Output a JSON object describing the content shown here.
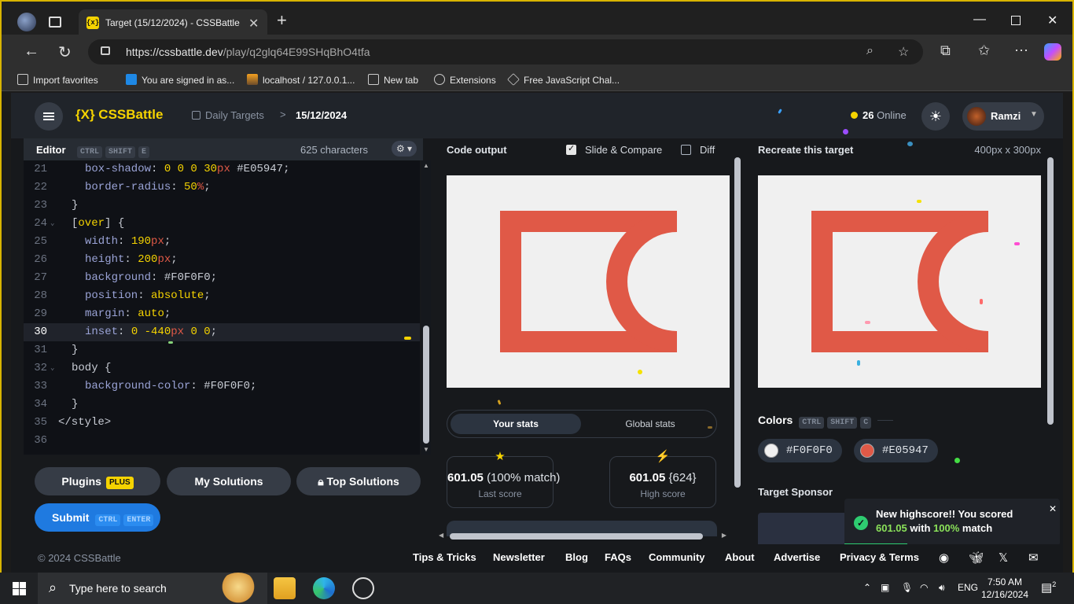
{
  "browser": {
    "tab_title": "Target (15/12/2024) - CSSBattle",
    "tab_favicon": "{x}",
    "url_host": "https://cssbattle.dev",
    "url_path": "/play/q2glq64E99SHqBhO4tfa",
    "bookmarks": [
      {
        "label": "Import favorites",
        "icon": "import-icon"
      },
      {
        "label": "You are signed in as...",
        "icon": "s-logo-icon"
      },
      {
        "label": "localhost / 127.0.0.1...",
        "icon": "phpmyadmin-icon"
      },
      {
        "label": "New tab",
        "icon": "page-icon"
      },
      {
        "label": "Extensions",
        "icon": "extensions-icon"
      },
      {
        "label": "Free JavaScript Chal...",
        "icon": "cube-icon"
      }
    ]
  },
  "header": {
    "logo": "{X} CSSBattle",
    "breadcrumb_root": "Daily Targets",
    "breadcrumb_sep": ">",
    "breadcrumb_current": "15/12/2024",
    "online_count": "26",
    "online_label": "Online",
    "user_name": "Ramzi"
  },
  "editor": {
    "title": "Editor",
    "shortcut": [
      "CTRL",
      "SHIFT",
      "E"
    ],
    "char_count": "625 characters",
    "active_line": 30,
    "lines": [
      {
        "no": "21",
        "indent": 2,
        "parts": [
          [
            "p",
            "box-shadow"
          ],
          [
            "s",
            ": "
          ],
          [
            "v",
            "0 0 0 30"
          ],
          [
            "u",
            "px"
          ],
          [
            "s",
            " #E05947;"
          ]
        ]
      },
      {
        "no": "22",
        "indent": 2,
        "parts": [
          [
            "p",
            "border-radius"
          ],
          [
            "s",
            ": "
          ],
          [
            "v",
            "50"
          ],
          [
            "u",
            "%"
          ],
          [
            "s",
            ";"
          ]
        ]
      },
      {
        "no": "23",
        "indent": 1,
        "parts": [
          [
            "k",
            "}"
          ]
        ]
      },
      {
        "no": "24",
        "indent": 1,
        "fold": true,
        "parts": [
          [
            "k",
            "["
          ],
          [
            "v",
            "over"
          ],
          [
            "k",
            "] {"
          ]
        ]
      },
      {
        "no": "25",
        "indent": 2,
        "parts": [
          [
            "p",
            "width"
          ],
          [
            "s",
            ": "
          ],
          [
            "v",
            "190"
          ],
          [
            "u",
            "px"
          ],
          [
            "s",
            ";"
          ]
        ]
      },
      {
        "no": "26",
        "indent": 2,
        "parts": [
          [
            "p",
            "height"
          ],
          [
            "s",
            ": "
          ],
          [
            "v",
            "200"
          ],
          [
            "u",
            "px"
          ],
          [
            "s",
            ";"
          ]
        ]
      },
      {
        "no": "27",
        "indent": 2,
        "parts": [
          [
            "p",
            "background"
          ],
          [
            "s",
            ": #F0F0F0;"
          ]
        ]
      },
      {
        "no": "28",
        "indent": 2,
        "parts": [
          [
            "p",
            "position"
          ],
          [
            "s",
            ": "
          ],
          [
            "v",
            "absolute"
          ],
          [
            "s",
            ";"
          ]
        ]
      },
      {
        "no": "29",
        "indent": 2,
        "parts": [
          [
            "p",
            "margin"
          ],
          [
            "s",
            ": "
          ],
          [
            "v",
            "auto"
          ],
          [
            "s",
            ";"
          ]
        ]
      },
      {
        "no": "30",
        "indent": 2,
        "parts": [
          [
            "p",
            "inset"
          ],
          [
            "s",
            ": "
          ],
          [
            "v",
            "0 -440"
          ],
          [
            "u",
            "px"
          ],
          [
            "v",
            " 0 0"
          ],
          [
            "s",
            ";"
          ]
        ]
      },
      {
        "no": "31",
        "indent": 1,
        "parts": [
          [
            "k",
            "}"
          ]
        ]
      },
      {
        "no": "32",
        "indent": 1,
        "fold": true,
        "parts": [
          [
            "k",
            "body {"
          ]
        ]
      },
      {
        "no": "33",
        "indent": 2,
        "parts": [
          [
            "p",
            "background-color"
          ],
          [
            "s",
            ": #F0F0F0;"
          ]
        ]
      },
      {
        "no": "34",
        "indent": 1,
        "parts": [
          [
            "k",
            "}"
          ]
        ]
      },
      {
        "no": "35",
        "indent": 0,
        "parts": [
          [
            "k",
            "</style>"
          ]
        ]
      },
      {
        "no": "36",
        "indent": 0,
        "parts": []
      }
    ]
  },
  "buttons": {
    "plugins": "Plugins",
    "plus_badge": "PLUS",
    "my_solutions": "My Solutions",
    "top_solutions": "Top Solutions",
    "submit": "Submit",
    "submit_keys": [
      "CTRL",
      "ENTER"
    ]
  },
  "output": {
    "title": "Code output",
    "slide_compare": "Slide & Compare",
    "slide_compare_checked": true,
    "diff": "Diff",
    "diff_checked": false,
    "tabs": [
      "Your stats",
      "Global stats"
    ],
    "last_score": {
      "value": "601.05",
      "detail": "(100% match)",
      "label": "Last score"
    },
    "high_score": {
      "value": "601.05",
      "detail": "{624}",
      "label": "High score"
    }
  },
  "target": {
    "title": "Recreate this target",
    "dimensions": "400px x 300px",
    "colors_label": "Colors",
    "colors_shortcut": [
      "CTRL",
      "SHIFT",
      "C"
    ],
    "colors": [
      {
        "hex": "#F0F0F0"
      },
      {
        "hex": "#E05947"
      }
    ],
    "sponsor_label": "Target Sponsor"
  },
  "toast": {
    "line1": "New highscore!! You scored",
    "score": "601.05",
    "with": "with",
    "match": "100%",
    "match_word": "match"
  },
  "footer": {
    "copyright": "© 2024 CSSBattle",
    "links": [
      "Tips & Tricks",
      "Newsletter",
      "Blog",
      "FAQs",
      "Community",
      "About",
      "Advertise",
      "Privacy & Terms"
    ],
    "socials": [
      "discord-icon",
      "bluesky-icon",
      "x-icon",
      "mail-icon"
    ]
  },
  "taskbar": {
    "search_placeholder": "Type here to search",
    "language": "ENG",
    "time": "7:50 AM",
    "date": "12/16/2024",
    "notifications": "2"
  },
  "colors": {
    "accent": "#F5D300",
    "brand_red": "#E05947",
    "canvas_bg": "#F0F0F0",
    "submit_blue": "#1F7AE0",
    "success_green": "#2ECC71"
  }
}
